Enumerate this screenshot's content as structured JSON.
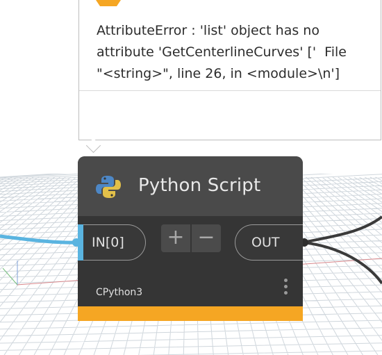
{
  "tooltip": {
    "icon": "warning-icon",
    "message": "AttributeError : 'list' object has no\nattribute 'GetCenterlineCurves' ['  File\n\"<string>\", line 26, in <module>\\n']"
  },
  "node": {
    "logo": "python-logo-icon",
    "title": "Python Script",
    "input_port": "IN[0]",
    "add_label": "+",
    "remove_label": "−",
    "output_port": "OUT",
    "engine": "CPython3",
    "more_icon": "more-vertical-icon",
    "status_color": "#f5a623",
    "input_wire_color": "#5ab4e0"
  }
}
